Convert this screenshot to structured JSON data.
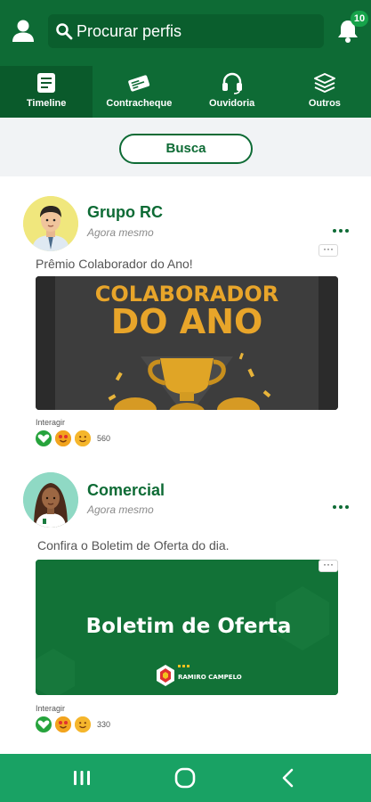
{
  "header": {
    "search": {
      "placeholder": "Procurar perfis"
    },
    "notifications": {
      "count": "10"
    }
  },
  "tabs": [
    {
      "label": "Timeline",
      "icon": "timeline-icon",
      "active": true
    },
    {
      "label": "Contracheque",
      "icon": "paycheck-icon",
      "active": false
    },
    {
      "label": "Ouvidoria",
      "icon": "headset-icon",
      "active": false
    },
    {
      "label": "Outros",
      "icon": "layers-icon",
      "active": false
    }
  ],
  "busca": {
    "label": "Busca"
  },
  "posts": [
    {
      "author": "Grupo RC",
      "time": "Agora mesmo",
      "caption": "Prêmio Colaborador do Ano!",
      "media": {
        "line1": "COLABORADOR",
        "line2": "DO ANO"
      },
      "interact_label": "Interagir",
      "reaction_count": "560"
    },
    {
      "author": "Comercial",
      "time": "Agora mesmo",
      "caption": "Confira o Boletim de Oferta do dia.",
      "media": {
        "title": "Boletim de Oferta",
        "logo_text": "RAMIRO CAMPELO"
      },
      "interact_label": "Interagir",
      "reaction_count": "330"
    }
  ],
  "colors": {
    "header_green": "#0e6b35",
    "nav_green": "#19a264",
    "accent_gold": "#e0a526"
  }
}
